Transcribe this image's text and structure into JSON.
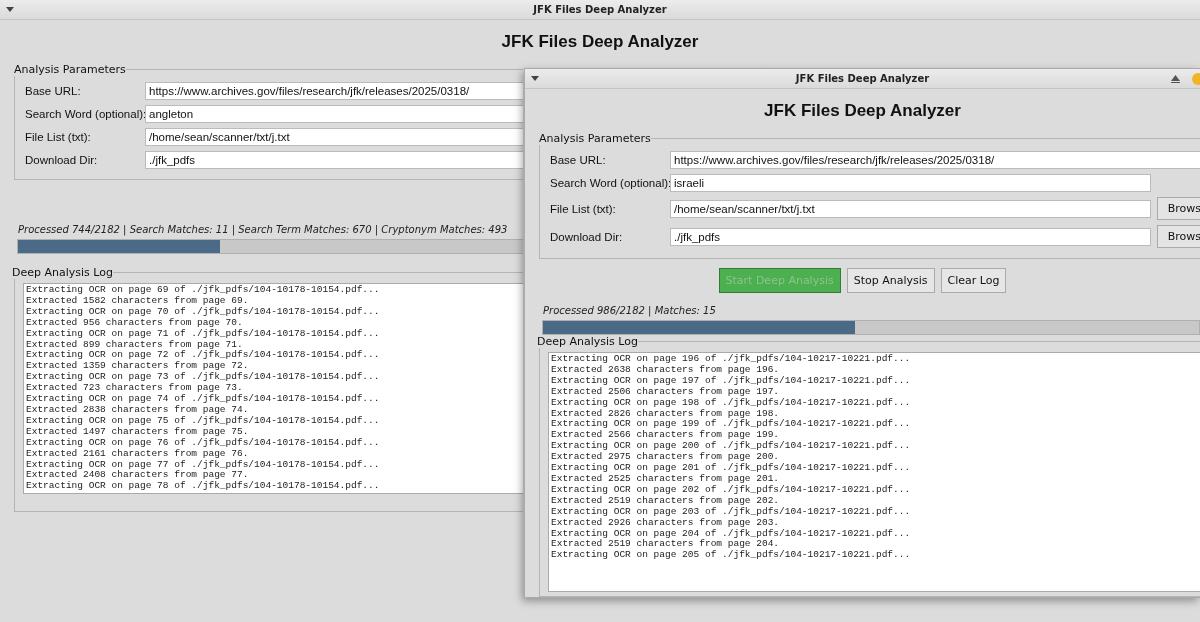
{
  "windows": [
    {
      "kind": "background",
      "title": "JFK Files Deep Analyzer",
      "heading": "JFK Files Deep Analyzer",
      "parameters": {
        "legend": "Analysis Parameters",
        "fields": [
          {
            "label": "Base URL:",
            "value": "https://www.archives.gov/files/research/jfk/releases/2025/0318/",
            "kind": "full"
          },
          {
            "label": "Search Word (optional):",
            "value": "angleton",
            "kind": "full"
          },
          {
            "label": "File List (txt):",
            "value": "/home/sean/scanner/txt/j.txt",
            "kind": "full"
          },
          {
            "label": "Download Dir:",
            "value": "./jfk_pdfs",
            "kind": "full"
          }
        ]
      },
      "status": "Processed 744/2182 | Search Matches: 11 | Search Term Matches: 670 | Cryptonym Matches: 493",
      "progress": {
        "level": 0.4
      },
      "log": {
        "legend": "Deep Analysis Log",
        "lines": [
          "Extracting OCR on page 69 of ./jfk_pdfs/104-10178-10154.pdf...",
          "Extracted 1582 characters from page 69.",
          "Extracting OCR on page 70 of ./jfk_pdfs/104-10178-10154.pdf...",
          "Extracted 956 characters from page 70.",
          "Extracting OCR on page 71 of ./jfk_pdfs/104-10178-10154.pdf...",
          "Extracted 899 characters from page 71.",
          "Extracting OCR on page 72 of ./jfk_pdfs/104-10178-10154.pdf...",
          "Extracted 1359 characters from page 72.",
          "Extracting OCR on page 73 of ./jfk_pdfs/104-10178-10154.pdf...",
          "Extracted 723 characters from page 73.",
          "Extracting OCR on page 74 of ./jfk_pdfs/104-10178-10154.pdf...",
          "Extracted 2838 characters from page 74.",
          "Extracting OCR on page 75 of ./jfk_pdfs/104-10178-10154.pdf...",
          "Extracted 1497 characters from page 75.",
          "Extracting OCR on page 76 of ./jfk_pdfs/104-10178-10154.pdf...",
          "Extracted 2161 characters from page 76.",
          "Extracting OCR on page 77 of ./jfk_pdfs/104-10178-10154.pdf...",
          "Extracted 2408 characters from page 77.",
          "Extracting OCR on page 78 of ./jfk_pdfs/104-10178-10154.pdf..."
        ]
      }
    },
    {
      "kind": "foreground",
      "title": "JFK Files Deep Analyzer",
      "heading": "JFK Files Deep Analyzer",
      "parameters": {
        "legend": "Analysis Parameters",
        "fields": [
          {
            "label": "Base URL:",
            "value": "https://www.archives.gov/files/research/jfk/releases/2025/0318/",
            "kind": "full"
          },
          {
            "label": "Search Word (optional):",
            "value": "israeli",
            "kind": "short"
          },
          {
            "label": "File List (txt):",
            "value": "/home/sean/scanner/txt/j.txt",
            "kind": "browse",
            "browse": "Brows"
          },
          {
            "label": "Download Dir:",
            "value": "./jfk_pdfs",
            "kind": "browse",
            "browse": "Brows"
          }
        ]
      },
      "buttons": [
        {
          "label": "Start Deep Analysis",
          "kind": "start",
          "disabled": true
        },
        {
          "label": "Stop Analysis",
          "kind": "plain",
          "disabled": false
        },
        {
          "label": "Clear Log",
          "kind": "plain",
          "disabled": false
        }
      ],
      "status": "Processed 986/2182 | Matches: 15",
      "progress": {
        "level": 0.475
      },
      "log": {
        "legend": "Deep Analysis Log",
        "lines": [
          "Extracting OCR on page 196 of ./jfk_pdfs/104-10217-10221.pdf...",
          "Extracted 2638 characters from page 196.",
          "Extracting OCR on page 197 of ./jfk_pdfs/104-10217-10221.pdf...",
          "Extracted 2506 characters from page 197.",
          "Extracting OCR on page 198 of ./jfk_pdfs/104-10217-10221.pdf...",
          "Extracted 2826 characters from page 198.",
          "Extracting OCR on page 199 of ./jfk_pdfs/104-10217-10221.pdf...",
          "Extracted 2566 characters from page 199.",
          "Extracting OCR on page 200 of ./jfk_pdfs/104-10217-10221.pdf...",
          "Extracted 2975 characters from page 200.",
          "Extracting OCR on page 201 of ./jfk_pdfs/104-10217-10221.pdf...",
          "Extracted 2525 characters from page 201.",
          "Extracting OCR on page 202 of ./jfk_pdfs/104-10217-10221.pdf...",
          "Extracted 2519 characters from page 202.",
          "Extracting OCR on page 203 of ./jfk_pdfs/104-10217-10221.pdf...",
          "Extracted 2926 characters from page 203.",
          "Extracting OCR on page 204 of ./jfk_pdfs/104-10217-10221.pdf...",
          "Extracted 2519 characters from page 204.",
          "Extracting OCR on page 205 of ./jfk_pdfs/104-10217-10221.pdf..."
        ]
      }
    }
  ]
}
